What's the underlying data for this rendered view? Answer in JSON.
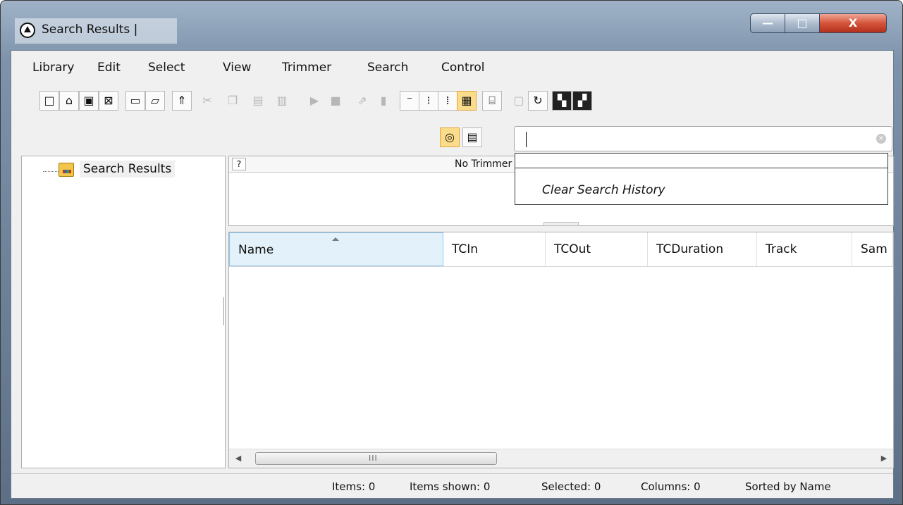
{
  "window": {
    "title": "Search Results |",
    "minimize_label": "—",
    "maximize_label": "□",
    "close_label": "X"
  },
  "menu": [
    "Library",
    "Edit",
    "Select",
    "View",
    "Trimmer",
    "Search",
    "Control"
  ],
  "toolbar": {
    "row1": [
      "new-document-icon",
      "open-file-icon",
      "save-icon",
      "close-document-icon",
      "new-folder-icon",
      "open-folder-icon",
      "up-folder-icon",
      "cut-icon",
      "copy-icon",
      "paste-icon",
      "paste-special-icon",
      "play-icon",
      "stop-icon",
      "export-icon",
      "import-icon",
      "view-details-icon",
      "view-list-icon",
      "view-small-icon",
      "view-columns-icon",
      "properties-icon",
      "monitor-icon",
      "refresh-icon",
      "record-add-icon",
      "record-insert-icon"
    ],
    "row2": [
      "globe-icon",
      "save-to-search-icon"
    ]
  },
  "search": {
    "value": "",
    "dropdown_item": "Clear Search History"
  },
  "tree": {
    "root_label": "Search Results"
  },
  "trimmer": {
    "question_label": "?",
    "title": "No Trimmer"
  },
  "grid": {
    "columns": [
      "Name",
      "TCIn",
      "TCOut",
      "TCDuration",
      "Track",
      "Sam"
    ],
    "sorted_column": "Name",
    "rows": []
  },
  "scrollbar": {
    "grip": "III",
    "left_arrow": "◀",
    "right_arrow": "▶"
  },
  "status": {
    "items": "Items: 0",
    "shown": "Items shown: 0",
    "selected": "Selected: 0",
    "columns": "Columns: 0",
    "sorted": "Sorted by Name"
  }
}
